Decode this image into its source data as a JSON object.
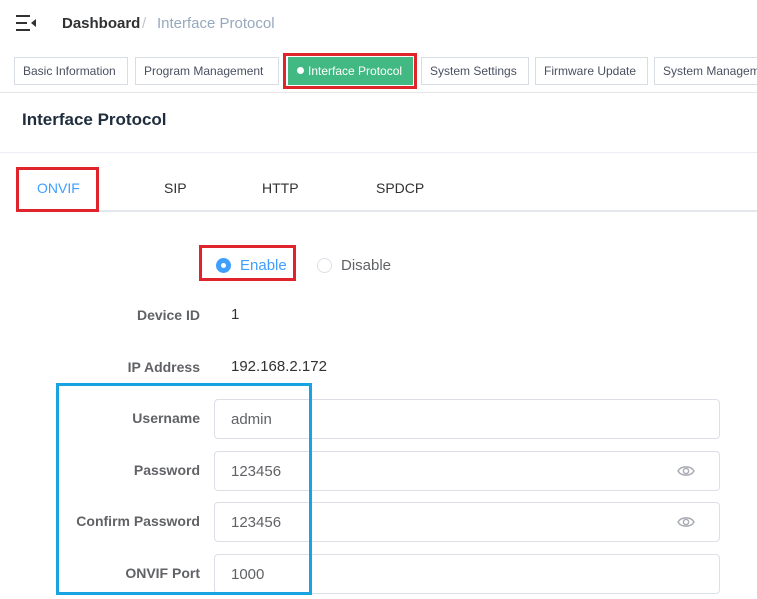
{
  "breadcrumb": {
    "home": "Dashboard",
    "separator": "/",
    "current": "Interface Protocol"
  },
  "tabs": [
    {
      "label": "Basic Information"
    },
    {
      "label": "Program Management"
    },
    {
      "label": "Interface Protocol",
      "active": true
    },
    {
      "label": "System Settings"
    },
    {
      "label": "Firmware Update"
    },
    {
      "label": "System Managem"
    }
  ],
  "page_title": "Interface Protocol",
  "protocol_tabs": [
    {
      "label": "ONVIF",
      "active": true
    },
    {
      "label": "SIP"
    },
    {
      "label": "HTTP"
    },
    {
      "label": "SPDCP"
    }
  ],
  "status": {
    "enable_label": "Enable",
    "disable_label": "Disable",
    "selected": "Enable"
  },
  "device": {
    "device_id_label": "Device ID",
    "device_id": "1",
    "ip_label": "IP Address",
    "ip": "192.168.2.172"
  },
  "form": {
    "username_label": "Username",
    "username": "admin",
    "password_label": "Password",
    "password": "123456",
    "confirm_label": "Confirm Password",
    "confirm": "123456",
    "port_label": "ONVIF Port",
    "port": "1000"
  },
  "colors": {
    "accent": "#409eff",
    "active_tab": "#42b983",
    "highlight_red": "#e0242b",
    "highlight_blue": "#19a3e3"
  },
  "icons": {
    "menu": "hamburger-fold-icon",
    "eye": "eye-icon"
  }
}
